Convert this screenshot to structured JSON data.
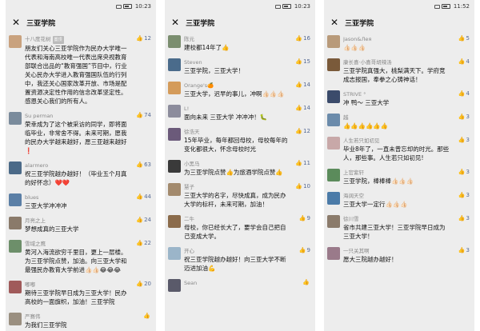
{
  "panels": [
    {
      "status": {
        "time": "10:23"
      },
      "title": "三亚学院",
      "comments": [
        {
          "name": "十八度花树",
          "tag": "置顶",
          "likes": "12",
          "avatar_color": "#c9a27e",
          "text": "朋友们关心三亚学院作为民办大学唯一代表和海南高校唯一代表出席央视教育部联合出品的“教育强国”节目中，行业关心民办大学进入教育强国队伍的行列中，我还关心国家改革开放、市场是配置资源决定性作用的信念改革坚定性。感恩关心我们的所有人。"
        },
        {
          "name": "Su perman",
          "likes": "74",
          "avatar_color": "#7a8b9c",
          "text": "荣幸成为了这个被采访的同学，即将面临毕业，非常舍不得。未来可期，愿我的民办大学越来越好，愿三亚越来越好❗"
        },
        {
          "name": "alarmero",
          "likes": "63",
          "avatar_color": "#4b6a88",
          "text": "祝三亚学院越办越好！（毕业五个月真的好怀念）❤️❤️"
        },
        {
          "name": "blues",
          "likes": "44",
          "avatar_color": "#5b7fa6",
          "text": "三亚大学冲冲冲"
        },
        {
          "name": "月亮之上",
          "likes": "24",
          "avatar_color": "#8a7a6a",
          "text": "梦想成真的三亚大学"
        },
        {
          "name": "雪域之鹰",
          "likes": "22",
          "avatar_color": "#6d8f6a",
          "text": "黄河入海流欲穷千里目，更上一层楼。为三亚学院点赞，加油。向三亚大学和最强民办教育大学前进👍🏻👍🏻😂😂😂"
        },
        {
          "name": "嘟嘟",
          "likes": "20",
          "avatar_color": "#a05a5a",
          "text": "期待三亚学院早日成为三亚大学！民办高校的一面旗帜，加油！三亚学院"
        },
        {
          "name": "严赛伟",
          "likes": "",
          "avatar_color": "#9a8f80",
          "text": "为我们三亚学院"
        }
      ]
    },
    {
      "status": {
        "time": "10:23"
      },
      "title": "三亚学院",
      "comments": [
        {
          "name": "陈元",
          "likes": "16",
          "avatar_color": "#7b8e6f",
          "text": "建校都14年了👍"
        },
        {
          "name": "Steven",
          "likes": "15",
          "avatar_color": "#4a6b8b",
          "text": "三亚学院，三亚大学！"
        },
        {
          "name": "Orange's🍊",
          "likes": "14",
          "avatar_color": "#d49b5a",
          "text": "三亚大学，迟早的事儿，冲啊👍🏻👍🏻👍🏻"
        },
        {
          "name": "L!",
          "likes": "14",
          "avatar_color": "#8c8c9c",
          "text": "面向未来 三亚大学 冲冲冲！🐛"
        },
        {
          "name": "徐浩天",
          "likes": "12",
          "avatar_color": "#6b5a7a",
          "text": "15年毕业，每年都回母校，母校每年的变化都很大，怀念母校时光"
        },
        {
          "name": "小黑马",
          "likes": "11",
          "avatar_color": "#3a3a3a",
          "text": "为三亚学院点赞👍为旅酒学院点赞👍"
        },
        {
          "name": "慧子",
          "likes": "10",
          "avatar_color": "#a38a6d",
          "text": "三亚大学的名字，尽快成真，成为民办大学的标杆，未来可期，加油！"
        },
        {
          "name": "二牛",
          "likes": "9",
          "avatar_color": "#8b6b4b",
          "text": "母校，你已经长大了，要学会自己把自己变成大学。"
        },
        {
          "name": "开心",
          "likes": "9",
          "avatar_color": "#9bb5c9",
          "text": "祝三亚学院越办越好！向三亚大学不断迈进加油💪"
        },
        {
          "name": "Sean",
          "likes": "",
          "avatar_color": "#5a5a6a",
          "text": ""
        }
      ]
    },
    {
      "status": {
        "time": "11:52"
      },
      "title": "三亚学院",
      "comments": [
        {
          "name": "Jason&Лея",
          "likes": "5",
          "avatar_color": "#b89a7a",
          "text": "👍🏻👍🏻👍🏻"
        },
        {
          "name": "康长喜·小喜哥胡辣汤",
          "likes": "4",
          "avatar_color": "#7a5a3a",
          "text": "三亚学院真强大，桃梨满天下。学府竞成志报国，奉拳之心铸神话！"
        },
        {
          "name": "STRIVE °",
          "likes": "4",
          "avatar_color": "#3b4b6b",
          "text": "冲 鸭～ 三亚大学"
        },
        {
          "name": "越",
          "likes": "3",
          "avatar_color": "#6b8bab",
          "text": "👍👍👍👍👍👍"
        },
        {
          "name": "人生若只如初见",
          "likes": "3",
          "avatar_color": "#c8a8a8",
          "text": "毕业8年了，一直未曾忘却的时光。那些人，那些事。人生若只如初见!"
        },
        {
          "name": "上官紫轩",
          "likes": "3",
          "avatar_color": "#5b8b5b",
          "text": "三亚学院，棒棒棒👍🏻👍🏻👍🏻"
        },
        {
          "name": "海阔天空",
          "likes": "3",
          "avatar_color": "#4b7ba8",
          "text": "三亚大学一定行👍🏻👍🏻👍🏻"
        },
        {
          "name": "徐川雪",
          "likes": "3",
          "avatar_color": "#8b7b6b",
          "text": "省市共建三亚大学！三亚学院早日成为三亚大学！"
        },
        {
          "name": "一只关其啊",
          "likes": "3",
          "avatar_color": "#9a7a8a",
          "text": "愿大三院越办越好！"
        }
      ]
    }
  ]
}
